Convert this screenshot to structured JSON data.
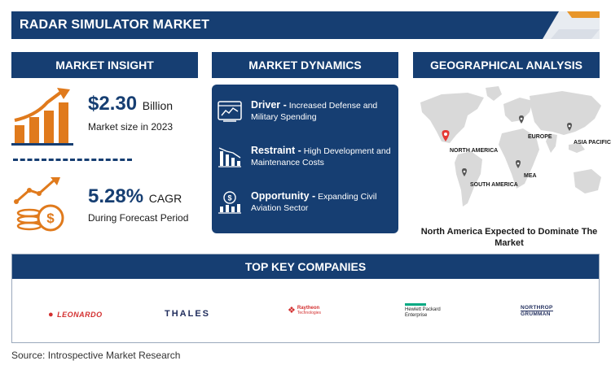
{
  "banner": {
    "title": "RADAR SIMULATOR MARKET"
  },
  "sections": {
    "insight": "MARKET INSIGHT",
    "dynamics": "MARKET DYNAMICS",
    "geo": "GEOGRAPHICAL ANALYSIS"
  },
  "insight": {
    "market_value": "$2.30",
    "market_unit": "Billion",
    "market_caption": "Market size in 2023",
    "cagr_value": "5.28%",
    "cagr_unit": "CAGR",
    "cagr_caption": "During Forecast Period"
  },
  "dynamics": {
    "driver_label": "Driver -",
    "driver_text": "Increased Defense and Military Spending",
    "restraint_label": "Restraint -",
    "restraint_text": "High Development and Maintenance Costs",
    "opportunity_label": "Opportunity -",
    "opportunity_text": "Expanding Civil Aviation Sector"
  },
  "geo": {
    "regions": {
      "north_america": "NORTH AMERICA",
      "europe": "EUROPE",
      "asia_pacific": "ASIA PACIFIC",
      "mea": "MEA",
      "south_america": "SOUTH AMERICA"
    },
    "caption": "North America Expected to Dominate The Market"
  },
  "companies": {
    "title": "TOP KEY COMPANIES",
    "leonardo": "LEONARDO",
    "thales": "THALES",
    "raytheon_1": "Raytheon",
    "raytheon_2": "Technologies",
    "hpe_1": "Hewlett Packard",
    "hpe_2": "Enterprise",
    "northrop_1": "NORTHROP",
    "northrop_2": "GRUMMAN"
  },
  "source": "Source: Introspective Market Research",
  "colors": {
    "navy": "#163e72",
    "orange": "#e07a1c",
    "accent_red": "#e53935"
  }
}
